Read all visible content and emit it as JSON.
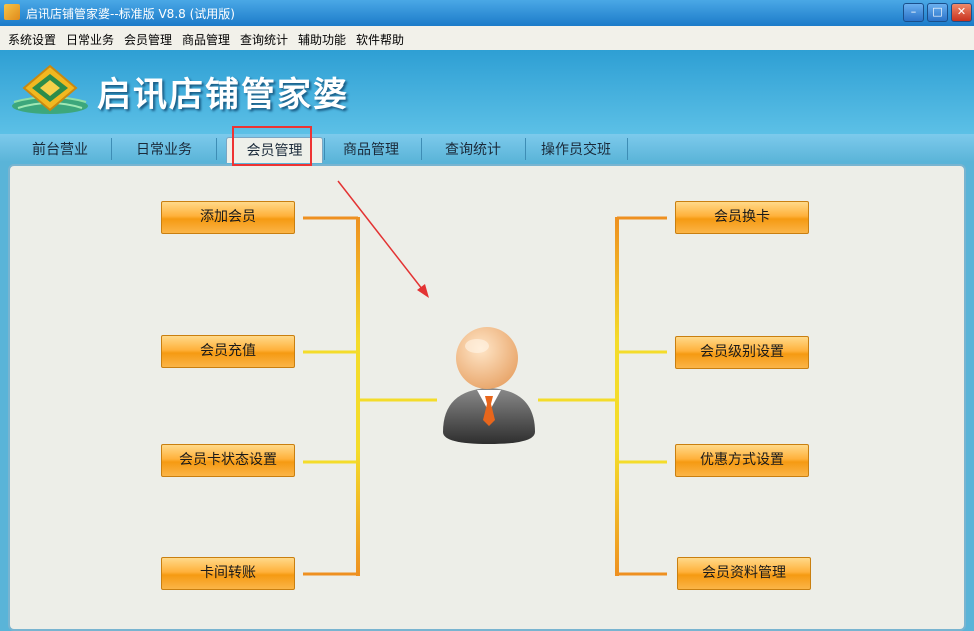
{
  "window": {
    "title": "启讯店铺管家婆--标准版 V8.8 (试用版)",
    "controls": {
      "minimize": "–",
      "maximize": "□",
      "close": "✕"
    }
  },
  "menu": [
    "系统设置",
    "日常业务",
    "会员管理",
    "商品管理",
    "查询统计",
    "辅助功能",
    "软件帮助"
  ],
  "banner": {
    "app_name": "启讯店铺管家婆"
  },
  "tabs": [
    {
      "label": "前台营业",
      "active": false
    },
    {
      "label": "日常业务",
      "active": false
    },
    {
      "label": "会员管理",
      "active": true
    },
    {
      "label": "商品管理",
      "active": false
    },
    {
      "label": "查询统计",
      "active": false
    },
    {
      "label": "操作员交班",
      "active": false
    }
  ],
  "left_buttons": [
    "添加会员",
    "会员充值",
    "会员卡状态设置",
    "卡间转账"
  ],
  "right_buttons": [
    "会员换卡",
    "会员级别设置",
    "优惠方式设置",
    "会员资料管理"
  ],
  "colors": {
    "accent_orange": "#ffb13b",
    "annotation_red": "#e33333",
    "connector_yellow": "#f4dc2a",
    "connector_orange": "#ee9020"
  },
  "icons": {
    "center": "user-avatar-icon",
    "logo": "diamond-logo-icon"
  }
}
